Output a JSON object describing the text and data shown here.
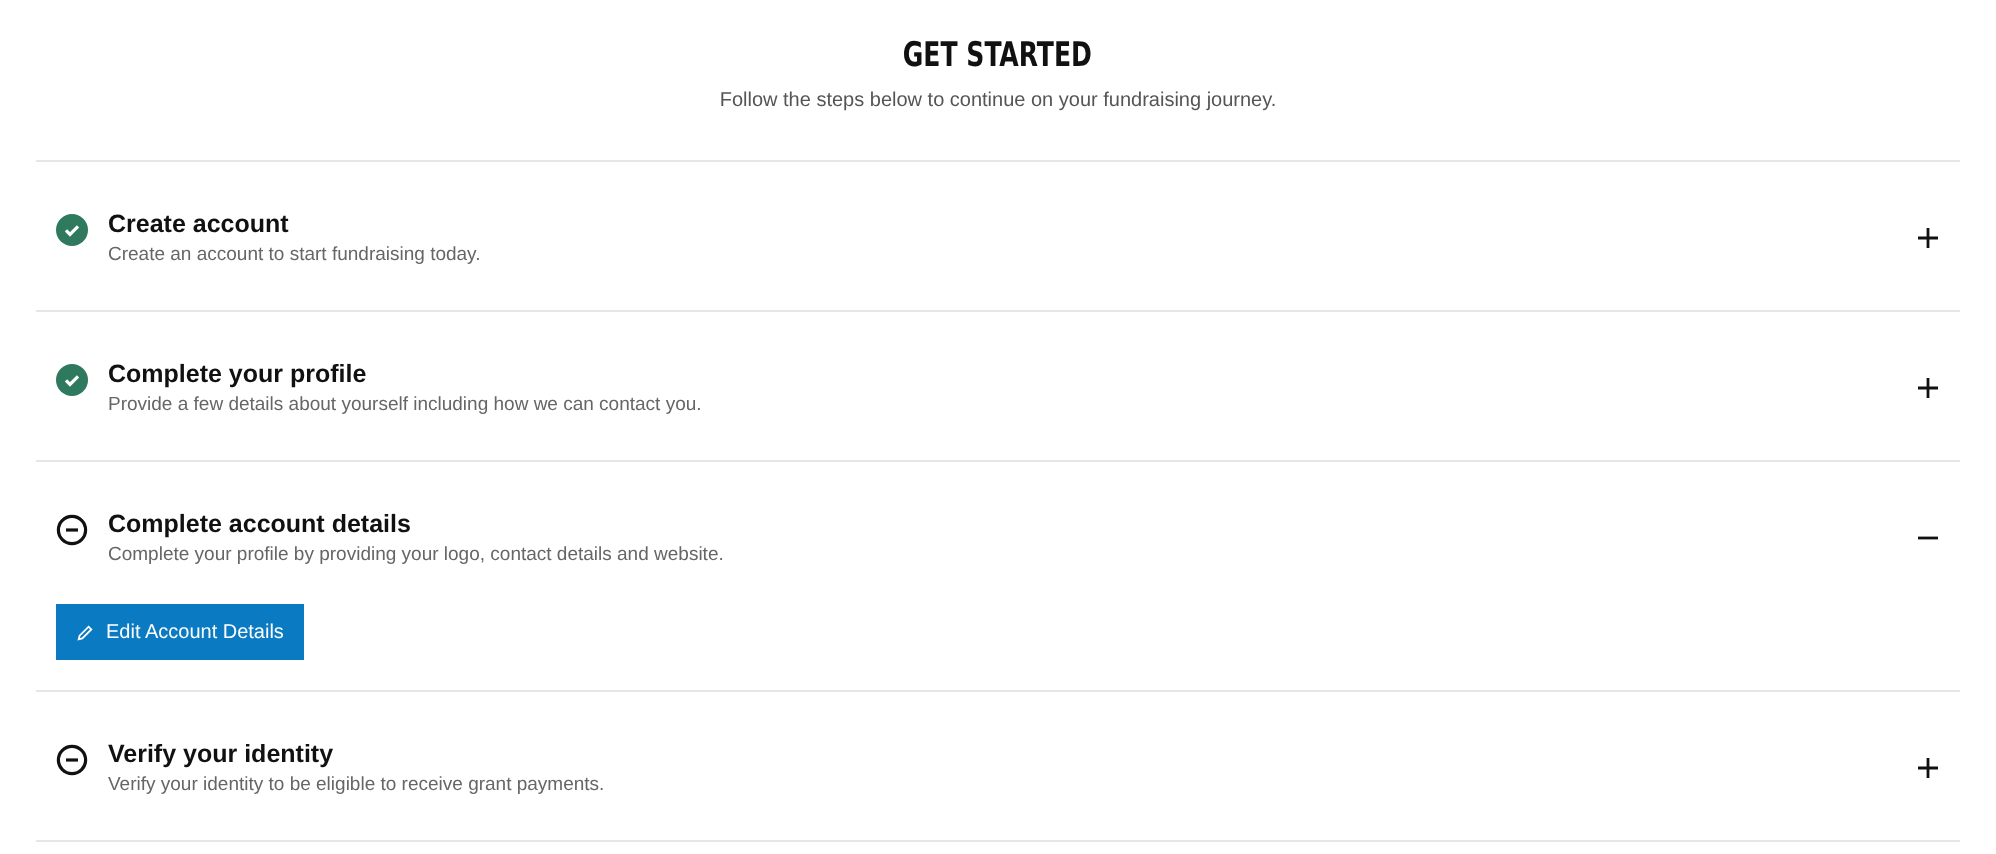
{
  "header": {
    "title": "GET STARTED",
    "subtitle": "Follow the steps below to continue on your fundraising journey."
  },
  "steps": [
    {
      "title": "Create account",
      "description": "Create an account to start fundraising today.",
      "completed": true,
      "expanded": false
    },
    {
      "title": "Complete your profile",
      "description": "Provide a few details about yourself including how we can contact you.",
      "completed": true,
      "expanded": false
    },
    {
      "title": "Complete account details",
      "description": "Complete your profile by providing your logo, contact details and website.",
      "completed": false,
      "expanded": true,
      "button": "Edit Account Details"
    },
    {
      "title": "Verify your identity",
      "description": "Verify your identity to be eligible to receive grant payments.",
      "completed": false,
      "expanded": false
    }
  ]
}
